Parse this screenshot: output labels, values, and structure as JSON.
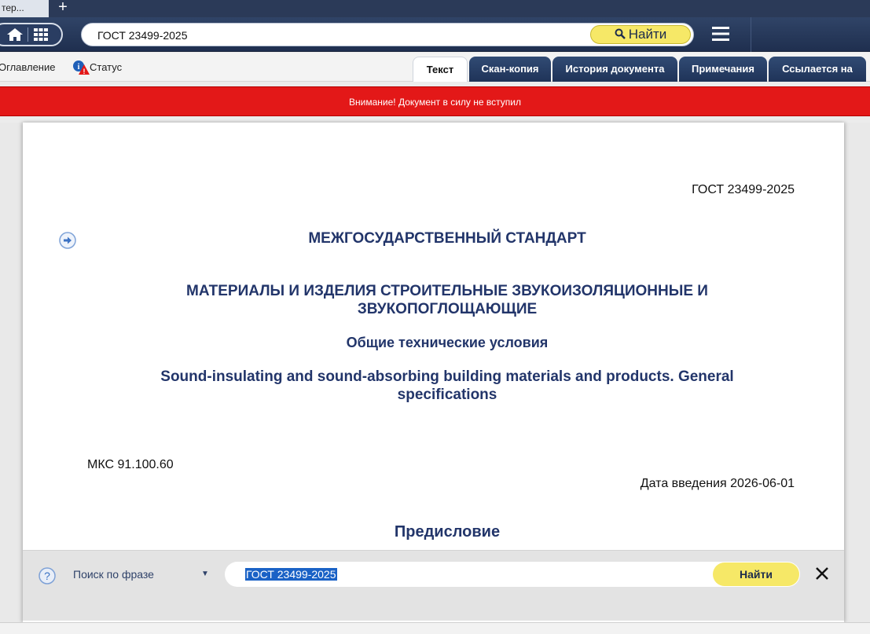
{
  "browser": {
    "tab_title": "тер...",
    "new_tab_glyph": "+"
  },
  "toolbar": {
    "search_value": "ГОСТ 23499-2025",
    "find_label": "Найти",
    "icons": [
      "home-icon",
      "grid-icon",
      "menu-icon"
    ]
  },
  "subbar": {
    "contents_label": "Оглавление",
    "status_label": "Статус",
    "tabs": [
      {
        "label": "Текст"
      },
      {
        "label": "Скан-копия"
      },
      {
        "label": "История документа"
      },
      {
        "label": "Примечания"
      },
      {
        "label": "Ссылается на"
      }
    ]
  },
  "warning": {
    "text": "Внимание! Документ в силу не вступил",
    "color": "#e31818"
  },
  "document": {
    "number": "ГОСТ 23499-2025",
    "heading1": "МЕЖГОСУДАРСТВЕННЫЙ СТАНДАРТ",
    "heading2_line1": "МАТЕРИАЛЫ И ИЗДЕЛИЯ СТРОИТЕЛЬНЫЕ ЗВУКОИЗОЛЯЦИОННЫЕ И",
    "heading2_line2": "ЗВУКОПОГЛОЩАЮЩИЕ",
    "heading3": "Общие технические условия",
    "heading4_line1": "Sound-insulating and sound-absorbing building materials and products. General",
    "heading4_line2": "specifications",
    "mks": "МКС 91.100.60",
    "intro_date": "Дата введения 2026-06-01",
    "section_title": "Предисловие"
  },
  "findpanel": {
    "mode_label": "Поиск по фразе",
    "query": "ГОСТ 23499-2025",
    "find_label": "Найти"
  },
  "colors": {
    "navy": "#22356a",
    "yellow": "#f6e867",
    "selection": "#1a62c6"
  }
}
